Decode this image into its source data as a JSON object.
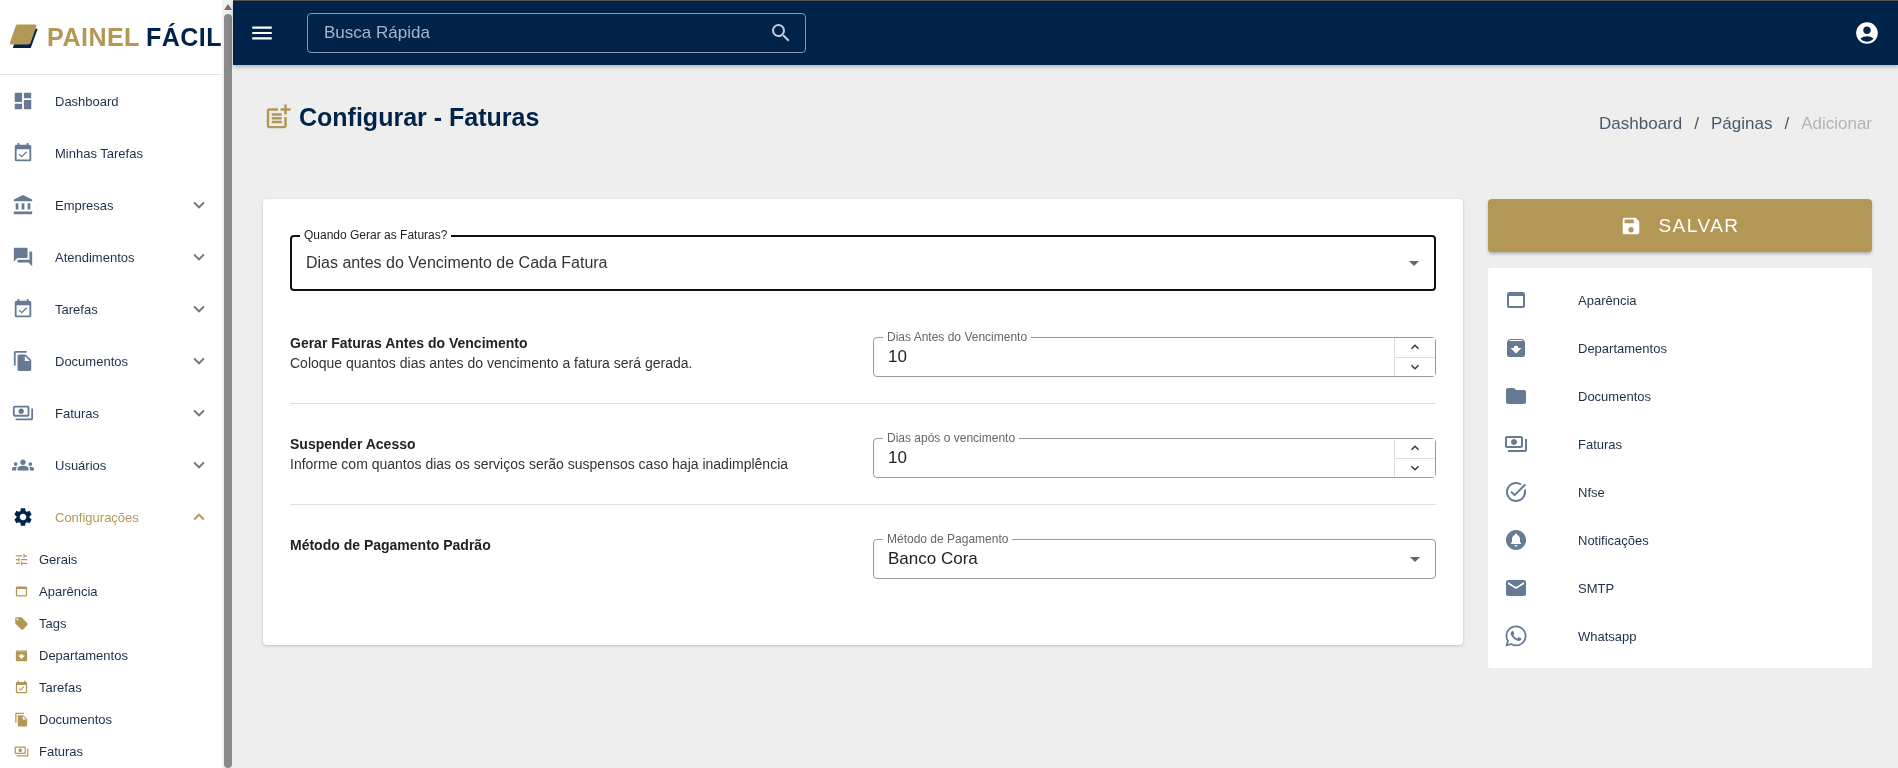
{
  "logo": {
    "part1": "PAINEL",
    "part2": "FÁCIL"
  },
  "sidebar": {
    "items": [
      {
        "label": "Dashboard",
        "kind": "link",
        "selected": false
      },
      {
        "label": "Minhas Tarefas",
        "kind": "link",
        "selected": false
      },
      {
        "label": "Empresas",
        "kind": "group",
        "expanded": false,
        "selected": false
      },
      {
        "label": "Atendimentos",
        "kind": "group",
        "expanded": false,
        "selected": false
      },
      {
        "label": "Tarefas",
        "kind": "group",
        "expanded": false,
        "selected": false
      },
      {
        "label": "Documentos",
        "kind": "group",
        "expanded": false,
        "selected": false
      },
      {
        "label": "Faturas",
        "kind": "group",
        "expanded": false,
        "selected": false
      },
      {
        "label": "Usuários",
        "kind": "group",
        "expanded": false,
        "selected": false
      },
      {
        "label": "Configurações",
        "kind": "group",
        "expanded": true,
        "selected": true,
        "children": [
          {
            "label": "Gerais"
          },
          {
            "label": "Aparência"
          },
          {
            "label": "Tags"
          },
          {
            "label": "Departamentos"
          },
          {
            "label": "Tarefas"
          },
          {
            "label": "Documentos"
          },
          {
            "label": "Faturas"
          }
        ]
      }
    ]
  },
  "search": {
    "placeholder": "Busca Rápida"
  },
  "page": {
    "title": "Configurar - Faturas"
  },
  "breadcrumb": [
    {
      "label": "Dashboard",
      "current": false
    },
    {
      "label": "Páginas",
      "current": false
    },
    {
      "label": "Adicionar",
      "current": true
    }
  ],
  "breadcrumb_separators": [
    "/",
    "/"
  ],
  "form": {
    "when": {
      "label": "Quando Gerar as Faturas?",
      "value": "Dias antes do Vencimento de Cada Fatura"
    },
    "rows": [
      {
        "title": "Gerar Faturas Antes do Vencimento",
        "description": "Coloque quantos dias antes do vencimento a fatura será gerada.",
        "kind": "number",
        "field_label": "Dias Antes do Vencimento",
        "value": "10"
      },
      {
        "title": "Suspender Acesso",
        "description": "Informe com quantos dias os serviços serão suspensos caso haja inadimplência",
        "kind": "number",
        "field_label": "Dias após o vencimento",
        "value": "10"
      },
      {
        "title": "Método de Pagamento Padrão",
        "kind": "select",
        "field_label": "Método de Pagamento",
        "value": "Banco Cora"
      }
    ]
  },
  "save_button": {
    "label": "SALVAR"
  },
  "settings_menu": [
    {
      "label": "Aparência"
    },
    {
      "label": "Departamentos"
    },
    {
      "label": "Documentos"
    },
    {
      "label": "Faturas"
    },
    {
      "label": "Nfse"
    },
    {
      "label": "Notificações"
    },
    {
      "label": "SMTP"
    },
    {
      "label": "Whatsapp"
    }
  ]
}
